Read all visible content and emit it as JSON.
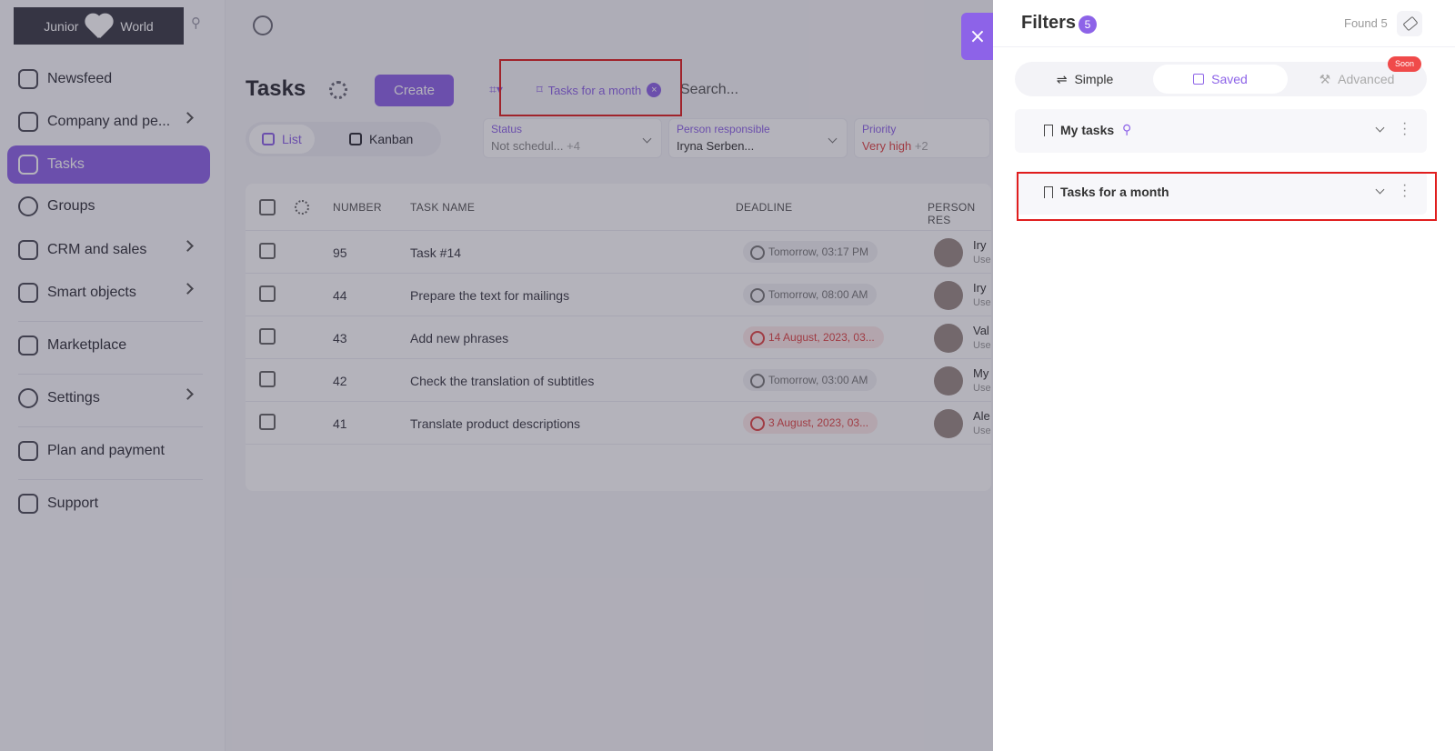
{
  "sidebar": {
    "logo_left": "Junior",
    "logo_right": "World",
    "items": [
      {
        "label": "Newsfeed"
      },
      {
        "label": "Company and pe..."
      },
      {
        "label": "Tasks"
      },
      {
        "label": "Groups"
      },
      {
        "label": "CRM and sales"
      },
      {
        "label": "Smart objects"
      },
      {
        "label": "Marketplace"
      },
      {
        "label": "Settings"
      },
      {
        "label": "Plan and payment"
      },
      {
        "label": "Support"
      }
    ]
  },
  "main": {
    "title": "Tasks",
    "create_label": "Create",
    "active_filter_chip": "Tasks for a month",
    "search_placeholder": "Search...",
    "views": {
      "list": "List",
      "kanban": "Kanban"
    },
    "filters": [
      {
        "label": "Status",
        "value": "Not schedul...",
        "more": "+4"
      },
      {
        "label": "Person responsible",
        "value": "Iryna Serben...",
        "more": ""
      },
      {
        "label": "Priority",
        "value": "Very high",
        "more": "+2"
      }
    ],
    "table": {
      "columns": [
        "NUMBER",
        "TASK NAME",
        "DEADLINE",
        "PERSON RES"
      ],
      "rows": [
        {
          "number": "95",
          "name": "Task #14",
          "deadline": "Tomorrow, 03:17 PM",
          "overdue": false,
          "person": "Iry",
          "role": "Use"
        },
        {
          "number": "44",
          "name": "Prepare the text for mailings",
          "deadline": "Tomorrow, 08:00 AM",
          "overdue": false,
          "person": "Iry",
          "role": "Use"
        },
        {
          "number": "43",
          "name": "Add new phrases",
          "deadline": "14 August, 2023, 03...",
          "overdue": true,
          "person": "Val",
          "role": "Use"
        },
        {
          "number": "42",
          "name": "Check the translation of subtitles",
          "deadline": "Tomorrow, 03:00 AM",
          "overdue": false,
          "person": "My",
          "role": "Use"
        },
        {
          "number": "41",
          "name": "Translate product descriptions",
          "deadline": "3 August, 2023, 03...",
          "overdue": true,
          "person": "Ale",
          "role": "Use"
        }
      ]
    }
  },
  "drawer": {
    "close_label": "×",
    "title": "Filters",
    "count": "5",
    "found": "Found 5",
    "tabs": {
      "simple": "Simple",
      "saved": "Saved",
      "advanced": "Advanced"
    },
    "soon_badge": "Soon",
    "saved_filters": [
      {
        "name": "My tasks",
        "pinned": true
      },
      {
        "name": "Tasks for a month",
        "pinned": false
      }
    ]
  },
  "colors": {
    "accent": "#8d63e8",
    "danger": "#e04545",
    "highlight": "#e01e1e"
  }
}
